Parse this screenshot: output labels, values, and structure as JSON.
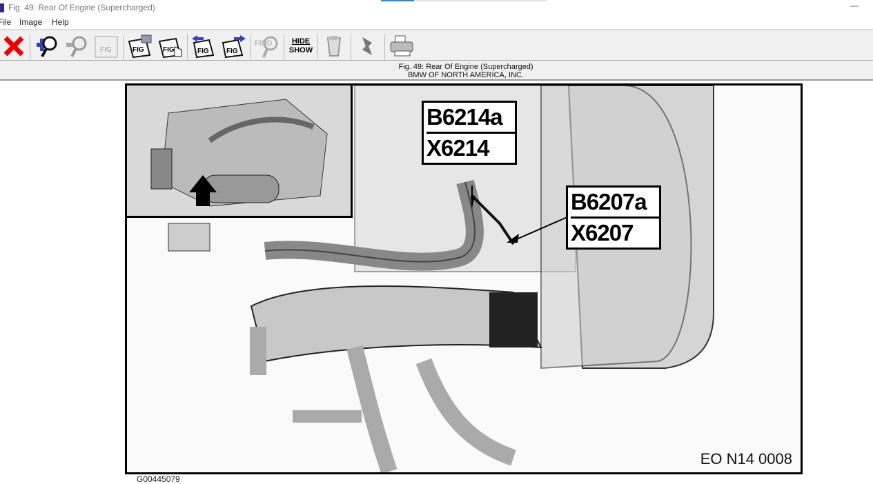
{
  "window": {
    "title": "Fig. 49: Rear Of Engine (Supercharged)",
    "minimize": "—"
  },
  "menu": [
    "File",
    "Image",
    "Help"
  ],
  "toolbar": {
    "hide": "HIDE",
    "show": "SHOW",
    "find": "FIND",
    "fig": "FIG"
  },
  "caption": {
    "line1": "Fig. 49: Rear Of Engine (Supercharged)",
    "line2": "BMW OF NORTH AMERICA, INC."
  },
  "figure": {
    "label1": {
      "top": "B6214a",
      "bottom": "X6214"
    },
    "label2": {
      "top": "B6207a",
      "bottom": "X6207"
    },
    "code": "EO N14 0008",
    "id": "G00445079"
  }
}
